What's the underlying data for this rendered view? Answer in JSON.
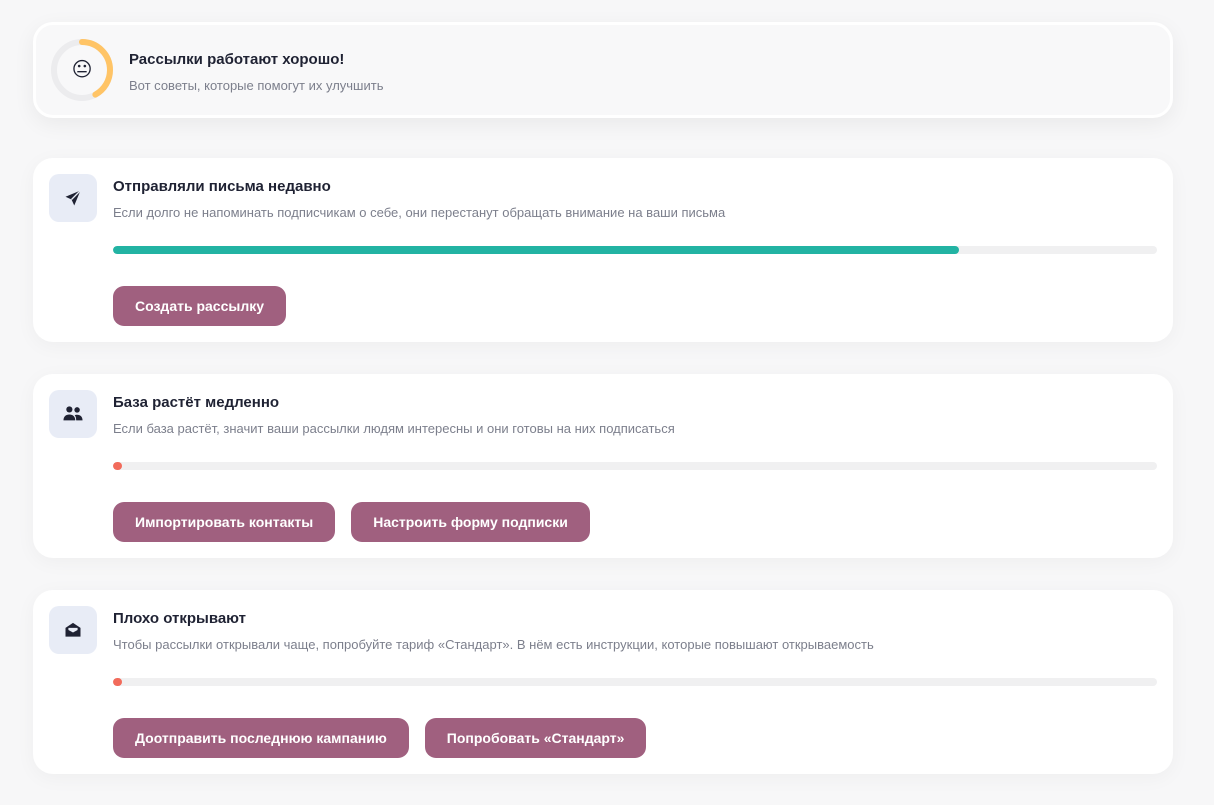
{
  "summary": {
    "title": "Рассылки работают хорошо!",
    "subtitle": "Вот советы, которые помогут их улучшить",
    "emoji": "😐",
    "score_fraction": 0.42,
    "ring_color": "#ffc466",
    "ring_track_color": "#ececee"
  },
  "tips": [
    {
      "icon": "paper-plane-icon",
      "title": "Отправляли письма недавно",
      "description": "Если долго не напоминать подписчикам о себе, они перестанут обращать внимание на ваши письма",
      "progress": 0.81,
      "progress_color": "#22b3a3",
      "buttons": [
        {
          "label": "Создать рассылку"
        }
      ]
    },
    {
      "icon": "users-icon",
      "title": "База растёт медленно",
      "description": "Если база растёт, значит ваши рассылки людям интересны и они готовы на них подписаться",
      "progress": 0.0,
      "progress_color": "#f26b5b",
      "buttons": [
        {
          "label": "Импортировать контакты"
        },
        {
          "label": "Настроить форму подписки"
        }
      ]
    },
    {
      "icon": "open-envelope-icon",
      "title": "Плохо открывают",
      "description": "Чтобы рассылки открывали чаще, попробуйте тариф «Стандарт». В нём есть инструкции, которые повышают открываемость",
      "progress": 0.0,
      "progress_color": "#f26b5b",
      "buttons": [
        {
          "label": "Доотправить последнюю кампанию"
        },
        {
          "label": "Попробовать «Стандарт»"
        }
      ]
    }
  ]
}
